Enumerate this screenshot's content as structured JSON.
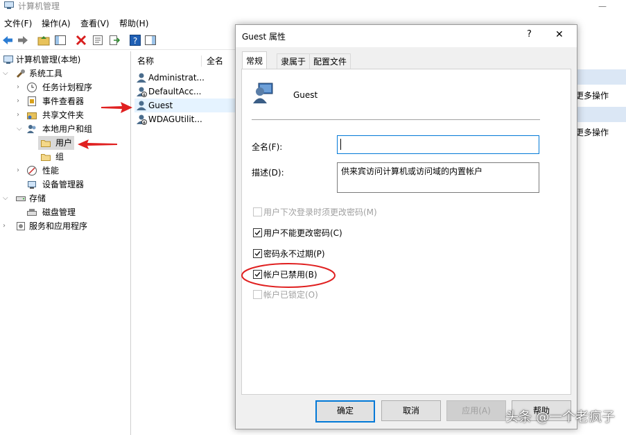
{
  "window": {
    "title": "计算机管理",
    "minimize": "—"
  },
  "menu": [
    "文件(F)",
    "操作(A)",
    "查看(V)",
    "帮助(H)"
  ],
  "tree": {
    "root": "计算机管理(本地)",
    "system_tools": "系统工具",
    "task_scheduler": "任务计划程序",
    "event_viewer": "事件查看器",
    "shared_folders": "共享文件夹",
    "local_users_groups": "本地用户和组",
    "users": "用户",
    "groups": "组",
    "performance": "性能",
    "device_manager": "设备管理器",
    "storage": "存储",
    "disk_management": "磁盘管理",
    "services_apps": "服务和应用程序"
  },
  "list": {
    "col_name": "名称",
    "col_fullname": "全名",
    "rows": [
      "Administrat...",
      "DefaultAcc...",
      "Guest",
      "WDAGUtilit..."
    ]
  },
  "actions": {
    "item1": "更多操作",
    "item2": "更多操作"
  },
  "dialog": {
    "title": "Guest 属性",
    "help": "?",
    "close": "✕",
    "tabs": [
      "常规",
      "隶属于",
      "配置文件"
    ],
    "username": "Guest",
    "fullname_label": "全名(F):",
    "fullname_value": "",
    "desc_label": "描述(D):",
    "desc_value": "供来宾访问计算机或访问域的内置帐户",
    "checkboxes": [
      {
        "label": "用户下次登录时须更改密码(M)",
        "checked": false,
        "disabled": true
      },
      {
        "label": "用户不能更改密码(C)",
        "checked": true,
        "disabled": false
      },
      {
        "label": "密码永不过期(P)",
        "checked": true,
        "disabled": false
      },
      {
        "label": "帐户已禁用(B)",
        "checked": true,
        "disabled": false
      },
      {
        "label": "帐户已锁定(O)",
        "checked": false,
        "disabled": true
      }
    ],
    "buttons": {
      "ok": "确定",
      "cancel": "取消",
      "apply": "应用(A)",
      "help": "帮助"
    }
  },
  "watermark": "头条 @一个老疯子",
  "colors": {
    "accent": "#0078d7",
    "annotation_red": "#e02020",
    "selection": "#cce8ff"
  }
}
